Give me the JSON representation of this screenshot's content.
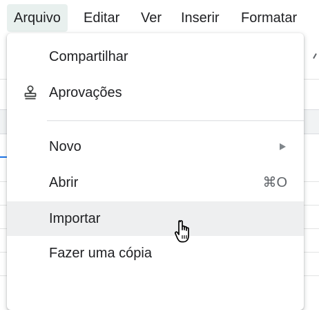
{
  "menubar": {
    "items": [
      {
        "label": "Arquivo",
        "active": true
      },
      {
        "label": "Editar",
        "active": false
      },
      {
        "label": "Ver",
        "active": false
      },
      {
        "label": "Inserir",
        "active": false
      },
      {
        "label": "Formatar",
        "active": false
      }
    ]
  },
  "file_menu": {
    "items": [
      {
        "label": "Compartilhar",
        "icon": null
      },
      {
        "label": "Aprovações",
        "icon": "stamp-icon"
      },
      {
        "label": "Novo",
        "icon": null,
        "submenu": true
      },
      {
        "label": "Abrir",
        "icon": null,
        "shortcut": "⌘O"
      },
      {
        "label": "Importar",
        "icon": null,
        "hovered": true
      },
      {
        "label": "Fazer uma cópia",
        "icon": null
      }
    ]
  },
  "cursor": {
    "type": "hand-pointer-icon"
  },
  "colors": {
    "active_menu_bg": "#e8f0ee",
    "hover_bg": "#eeeff0",
    "text": "#202124",
    "secondary_text": "#5f6368",
    "divider": "#dadce0"
  }
}
